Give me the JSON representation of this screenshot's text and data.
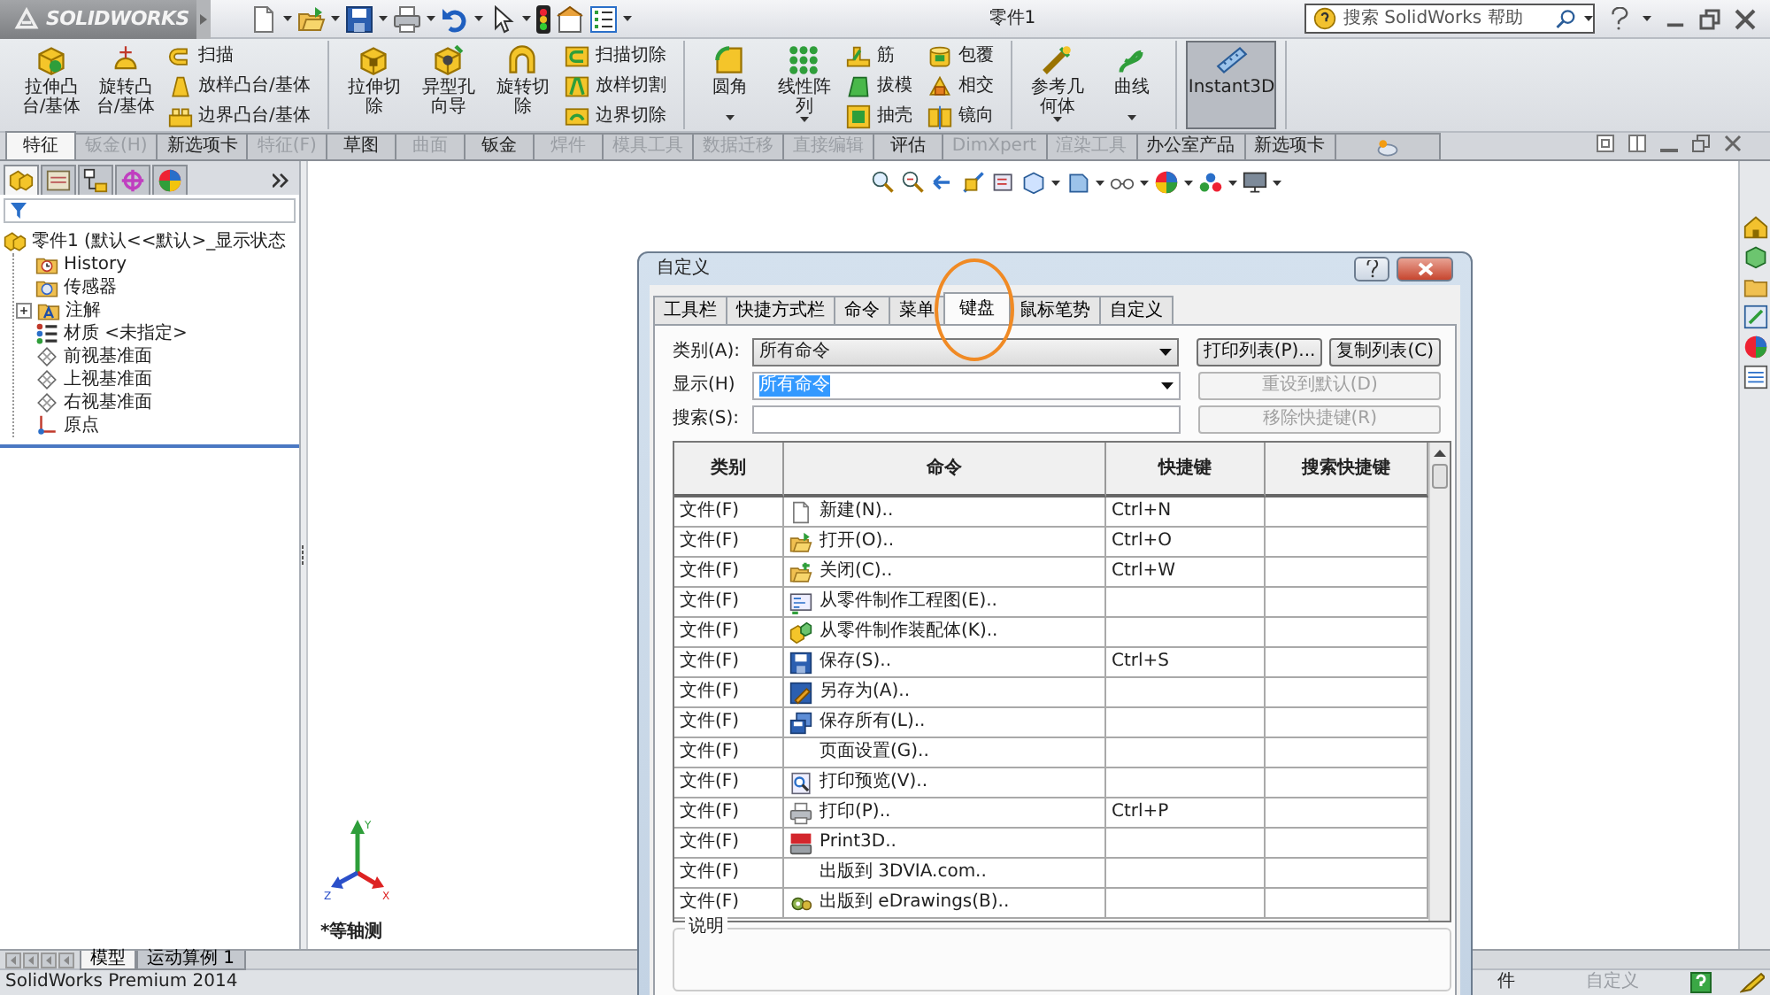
{
  "app": {
    "logo": "SOLIDWORKS",
    "title": "零件1",
    "help_search": {
      "placeholder": "搜索 SolidWorks 帮助"
    }
  },
  "ribbon": {
    "groups": [
      {
        "large": [
          {
            "label": "拉伸凸台/基体",
            "kind": "extrude",
            "dropdown": false,
            "pressed": false
          },
          {
            "label": "旋转凸台/基体",
            "kind": "revolve",
            "dropdown": false,
            "pressed": false
          }
        ],
        "columns": [
          [
            {
              "label": "扫描",
              "kind": "sweep"
            },
            {
              "label": "放样凸台/基体",
              "kind": "loft"
            },
            {
              "label": "边界凸台/基体",
              "kind": "boundary"
            }
          ]
        ]
      },
      {
        "large": [
          {
            "label": "拉伸切除",
            "kind": "cut-extrude",
            "dropdown": false,
            "pressed": false
          },
          {
            "label": "异型孔向导",
            "kind": "hole",
            "dropdown": false,
            "pressed": false
          },
          {
            "label": "旋转切除",
            "kind": "cut-revolve",
            "dropdown": false,
            "pressed": false
          }
        ],
        "columns": [
          [
            {
              "label": "扫描切除",
              "kind": "cut-sweep"
            },
            {
              "label": "放样切割",
              "kind": "cut-loft"
            },
            {
              "label": "边界切除",
              "kind": "cut-boundary"
            }
          ]
        ]
      },
      {
        "large": [
          {
            "label": "圆角",
            "kind": "fillet",
            "dropdown": true,
            "pressed": false
          },
          {
            "label": "线性阵列",
            "kind": "pattern",
            "dropdown": true,
            "pressed": false
          }
        ],
        "columns": [
          [
            {
              "label": "筋",
              "kind": "rib"
            },
            {
              "label": "拔模",
              "kind": "draft"
            },
            {
              "label": "抽壳",
              "kind": "shell"
            }
          ],
          [
            {
              "label": "包覆",
              "kind": "wrap"
            },
            {
              "label": "相交",
              "kind": "intersect"
            },
            {
              "label": "镜向",
              "kind": "mirror"
            }
          ]
        ]
      },
      {
        "large": [
          {
            "label": "参考几何体",
            "kind": "refgeom",
            "dropdown": true,
            "pressed": false
          },
          {
            "label": "曲线",
            "kind": "curve",
            "dropdown": true,
            "pressed": false
          }
        ]
      },
      {
        "large": [
          {
            "label": "Instant3D",
            "kind": "instant3d",
            "dropdown": false,
            "pressed": true
          }
        ]
      }
    ]
  },
  "command_tabs": [
    {
      "label": "特征",
      "selected": true,
      "disabled": false
    },
    {
      "label": "钣金(H)",
      "selected": false,
      "disabled": true
    },
    {
      "label": "新选项卡",
      "selected": false,
      "disabled": false
    },
    {
      "label": "特征(F)",
      "selected": false,
      "disabled": true
    },
    {
      "label": "草图",
      "selected": false,
      "disabled": false
    },
    {
      "label": "曲面",
      "selected": false,
      "disabled": true
    },
    {
      "label": "钣金",
      "selected": false,
      "disabled": false
    },
    {
      "label": "焊件",
      "selected": false,
      "disabled": true
    },
    {
      "label": "模具工具",
      "selected": false,
      "disabled": true
    },
    {
      "label": "数据迁移",
      "selected": false,
      "disabled": true
    },
    {
      "label": "直接编辑",
      "selected": false,
      "disabled": true
    },
    {
      "label": "评估",
      "selected": false,
      "disabled": false
    },
    {
      "label": "DimXpert",
      "selected": false,
      "disabled": true
    },
    {
      "label": "渲染工具",
      "selected": false,
      "disabled": true
    },
    {
      "label": "办公室产品",
      "selected": false,
      "disabled": false
    },
    {
      "label": "新选项卡",
      "selected": false,
      "disabled": false
    }
  ],
  "feature_manager": {
    "tabs": [
      {
        "selected": true
      },
      {
        "selected": false
      },
      {
        "selected": false
      },
      {
        "selected": false
      },
      {
        "selected": false
      }
    ],
    "tree": [
      {
        "label": "零件1 (默认<<默认>_显示状态",
        "kind": "part",
        "children": [
          {
            "label": "History",
            "kind": "history"
          },
          {
            "label": "传感器",
            "kind": "sensors"
          },
          {
            "label": "注解",
            "kind": "annotations",
            "expanded": false
          },
          {
            "label": "材质 <未指定>",
            "kind": "material"
          },
          {
            "label": "前视基准面",
            "kind": "plane"
          },
          {
            "label": "上视基准面",
            "kind": "plane"
          },
          {
            "label": "右视基准面",
            "kind": "plane"
          },
          {
            "label": "原点",
            "kind": "origin"
          }
        ]
      }
    ]
  },
  "graphics": {
    "view_label": "*等轴测",
    "triad": {
      "x": "X",
      "y": "Y",
      "z": "Z"
    }
  },
  "model_tabs": [
    {
      "label": "模型",
      "selected": true
    },
    {
      "label": "运动算例 1",
      "selected": false
    }
  ],
  "status_bar": {
    "product": "SolidWorks Premium 2014",
    "document_type": "件",
    "custom": {
      "label": "自定义",
      "disabled": true
    }
  },
  "dialog": {
    "title": "自定义",
    "tabs": [
      {
        "label": "工具栏",
        "selected": false
      },
      {
        "label": "快捷方式栏",
        "selected": false
      },
      {
        "label": "命令",
        "selected": false
      },
      {
        "label": "菜单",
        "selected": false
      },
      {
        "label": "键盘",
        "selected": true
      },
      {
        "label": "鼠标笔势",
        "selected": false
      },
      {
        "label": "自定义",
        "selected": false
      }
    ],
    "fields": [
      {
        "label": "类别(A):",
        "value": "所有命令",
        "editable": false,
        "value_selected": false,
        "buttons": [
          {
            "label": "打印列表(P)...",
            "disabled": false
          },
          {
            "label": "复制列表(C)",
            "disabled": false
          }
        ]
      },
      {
        "label": "显示(H)",
        "value": "所有命令",
        "editable": true,
        "value_selected": true,
        "buttons": [
          {
            "label": "重设到默认(D)",
            "disabled": true
          }
        ]
      },
      {
        "label": "搜索(S):",
        "editable": true,
        "buttons": [
          {
            "label": "移除快捷键(R)",
            "disabled": true
          }
        ]
      }
    ],
    "table": {
      "columns": [
        "类别",
        "命令",
        "快捷键",
        "搜索快捷键"
      ],
      "rows": [
        {
          "category": "文件(F)",
          "command": "新建(N)..",
          "kind": "new",
          "shortcut": "Ctrl+N"
        },
        {
          "category": "文件(F)",
          "command": "打开(O)..",
          "kind": "open",
          "shortcut": "Ctrl+O"
        },
        {
          "category": "文件(F)",
          "command": "关闭(C)..",
          "kind": "close",
          "shortcut": "Ctrl+W"
        },
        {
          "category": "文件(F)",
          "command": "从零件制作工程图(E)..",
          "kind": "drawing"
        },
        {
          "category": "文件(F)",
          "command": "从零件制作装配体(K)..",
          "kind": "assembly"
        },
        {
          "category": "文件(F)",
          "command": "保存(S)..",
          "kind": "save",
          "shortcut": "Ctrl+S"
        },
        {
          "category": "文件(F)",
          "command": "另存为(A)..",
          "kind": "save-as"
        },
        {
          "category": "文件(F)",
          "command": "保存所有(L)..",
          "kind": "save-all"
        },
        {
          "category": "文件(F)",
          "command": "页面设置(G).."
        },
        {
          "category": "文件(F)",
          "command": "打印预览(V)..",
          "kind": "preview"
        },
        {
          "category": "文件(F)",
          "command": "打印(P)..",
          "kind": "print",
          "shortcut": "Ctrl+P"
        },
        {
          "category": "文件(F)",
          "command": "Print3D..",
          "kind": "print3d"
        },
        {
          "category": "文件(F)",
          "command": "出版到 3DVIA.com.."
        },
        {
          "category": "文件(F)",
          "command": "出版到 eDrawings(B)..",
          "kind": "edrawings"
        }
      ]
    },
    "description_label": "说明"
  }
}
